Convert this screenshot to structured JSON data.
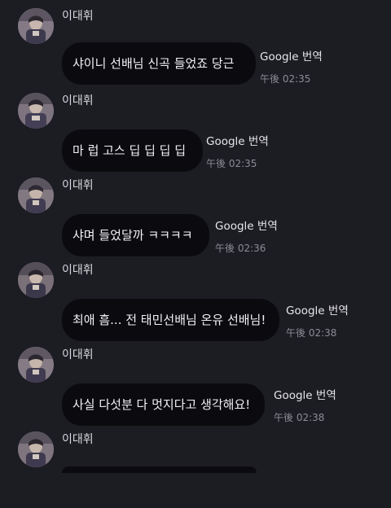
{
  "messages": [
    {
      "sender": "이대휘",
      "text": "샤이니 선배님 신곡 들었죠 당근",
      "translate_label": "Google 번역",
      "time": "午後 02:35"
    },
    {
      "sender": "이대휘",
      "text": "마 럽 고스 딥 딥 딥 딥",
      "translate_label": "Google 번역",
      "time": "午後 02:35"
    },
    {
      "sender": "이대휘",
      "text": "샤며 들었달까 ㅋㅋㅋㅋ",
      "translate_label": "Google 번역",
      "time": "午後 02:36"
    },
    {
      "sender": "이대휘",
      "text": "최애 흠... 전 태민선배님 온유 선배님!",
      "translate_label": "Google 번역",
      "time": "午後 02:38"
    },
    {
      "sender": "이대휘",
      "text": "사실 다섯분 다 멋지다고 생각해요!",
      "translate_label": "Google 번역",
      "time": "午後 02:38"
    },
    {
      "sender": "이대휘"
    }
  ]
}
